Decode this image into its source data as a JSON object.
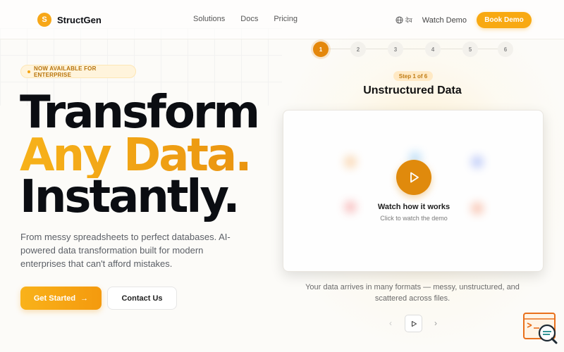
{
  "brand": {
    "logo_letter": "S",
    "name": "StructGen",
    "accent": "#f8a912"
  },
  "nav": {
    "items": [
      "Solutions",
      "Docs",
      "Pricing"
    ]
  },
  "header_right": {
    "language": "देव",
    "watch_demo": "Watch Demo",
    "book_demo": "Book Demo"
  },
  "hero": {
    "badge": "NOW AVAILABLE FOR ENTERPRISE",
    "line1": "Transform",
    "line2": "Any Data.",
    "line3": "Instantly.",
    "subtitle": "From messy spreadsheets to perfect databases. AI-powered data transformation built for modern enterprises that can't afford mistakes.",
    "cta_primary": "Get Started",
    "cta_arrow": "→",
    "cta_secondary": "Contact Us"
  },
  "demo": {
    "steps": [
      "1",
      "2",
      "3",
      "4",
      "5",
      "6"
    ],
    "active_step": 1,
    "step_label": "Step 1 of 6",
    "title": "Unstructured Data",
    "video_title": "Watch how it works",
    "video_subtitle": "Click to watch the demo",
    "description": "Your data arrives in many formats — messy, unstructured, and scattered across files.",
    "prev_symbol": "‹",
    "next_symbol": "›"
  },
  "icons": {
    "globe": "globe-icon",
    "play": "play-icon",
    "arrow": "arrow-right-icon",
    "chat": "chat-support-icon"
  }
}
